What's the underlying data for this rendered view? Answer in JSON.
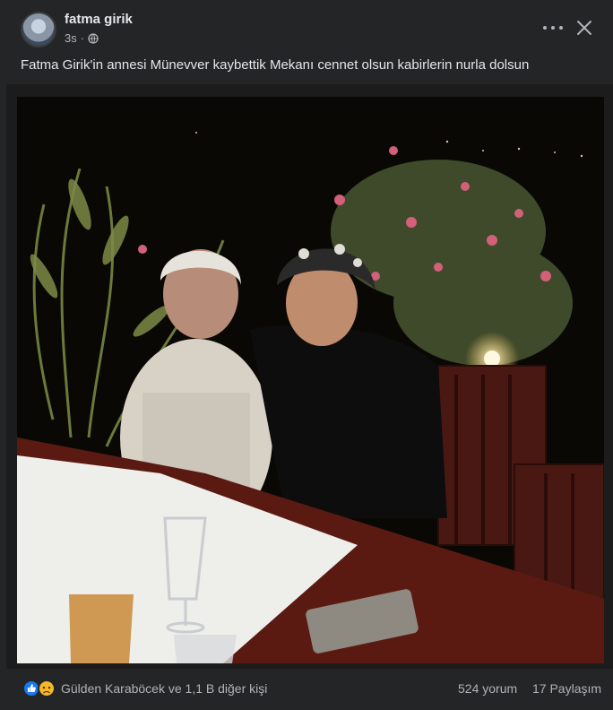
{
  "post": {
    "author": "fatma girik",
    "time": "3s",
    "separator": "·",
    "caption": "Fatma Girik'in annesi Münevver kaybettik Mekanı cennet olsun kabirlerin nurla dolsun"
  },
  "reactions": {
    "summary": "Gülden Karaböcek ve 1,1 B diğer kişi",
    "comments": "524 yorum",
    "shares": "17 Paylaşım",
    "colors": {
      "like": "#1877f2",
      "sad": "#f7b928"
    }
  },
  "icons": [
    "globe-icon",
    "more-icon",
    "close-icon",
    "like-reaction-icon",
    "sad-reaction-icon"
  ]
}
